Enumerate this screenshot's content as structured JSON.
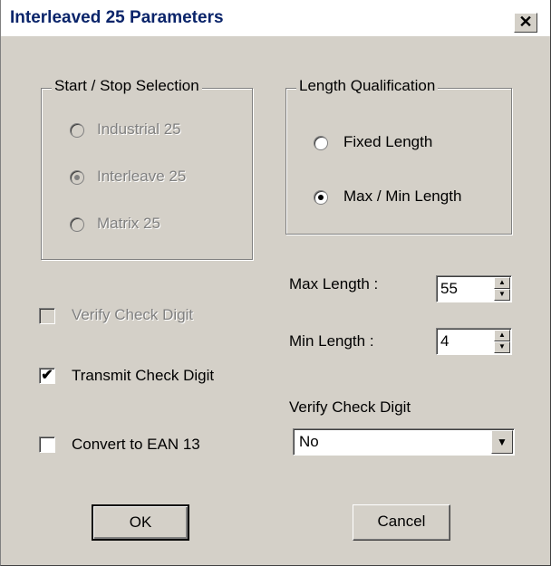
{
  "window": {
    "title": "Interleaved 25 Parameters",
    "close_glyph": "✕"
  },
  "start_stop": {
    "legend": "Start / Stop Selection",
    "options": [
      {
        "label": "Industrial 25",
        "selected": false
      },
      {
        "label": "Interleave 25",
        "selected": true
      },
      {
        "label": "Matrix 25",
        "selected": false
      }
    ]
  },
  "length_qual": {
    "legend": "Length Qualification",
    "options": [
      {
        "label": "Fixed Length",
        "selected": false
      },
      {
        "label": "Max / Min Length",
        "selected": true
      }
    ]
  },
  "max_length": {
    "label": "Max Length :",
    "value": "55"
  },
  "min_length": {
    "label": "Min Length :",
    "value": "4"
  },
  "checkboxes": {
    "verify": {
      "label": "Verify Check Digit",
      "checked": false
    },
    "transmit": {
      "label": "Transmit Check Digit",
      "checked": true
    },
    "convert": {
      "label": "Convert to EAN 13",
      "checked": false
    }
  },
  "verify_select": {
    "label": "Verify Check Digit",
    "value": "No"
  },
  "buttons": {
    "ok": "OK",
    "cancel": "Cancel"
  }
}
